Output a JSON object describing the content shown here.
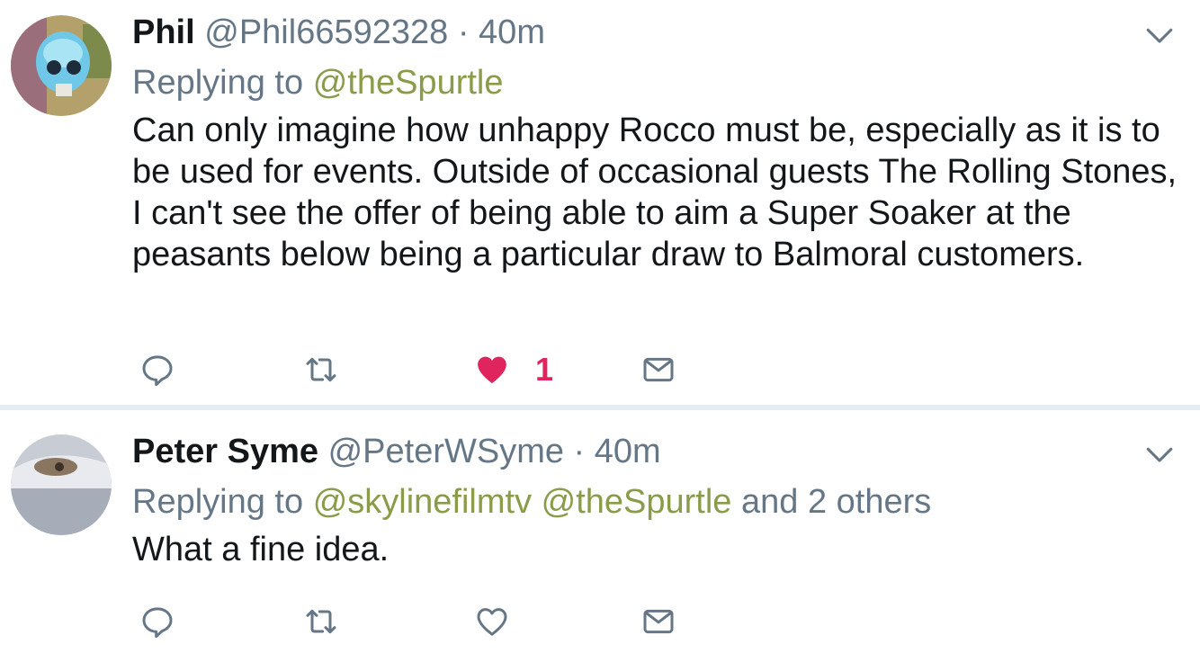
{
  "tweets": [
    {
      "name": "Phil",
      "handle": "@Phil66592328",
      "separator": "·",
      "time": "40m",
      "replying_prefix": "Replying to",
      "mentions": [
        "@theSpurtle"
      ],
      "replying_suffix": "",
      "text": "Can only imagine how unhappy Rocco must be, especially as it is to be used for events. Outside of occasional guests The Rolling Stones, I can't see the offer of being able to aim a Super Soaker at the peasants below being a particular draw to Balmoral customers.",
      "liked": true,
      "like_count": "1",
      "icons": [
        "reply-icon",
        "retweet-icon",
        "heart-filled-icon",
        "direct-message-icon"
      ]
    },
    {
      "name": "Peter Syme",
      "handle": "@PeterWSyme",
      "separator": "·",
      "time": "40m",
      "replying_prefix": "Replying to",
      "mentions": [
        "@skylinefilmtv",
        "@theSpurtle"
      ],
      "replying_suffix": "and 2 others",
      "text": "What a fine idea.",
      "liked": false,
      "like_count": "",
      "icons": [
        "reply-icon",
        "retweet-icon",
        "heart-outline-icon",
        "direct-message-icon"
      ]
    }
  ],
  "colors": {
    "name": "#14171a",
    "secondary": "#657786",
    "mention": "#8a9b4a",
    "like": "#e0245e",
    "divider": "#e6ecf0"
  }
}
